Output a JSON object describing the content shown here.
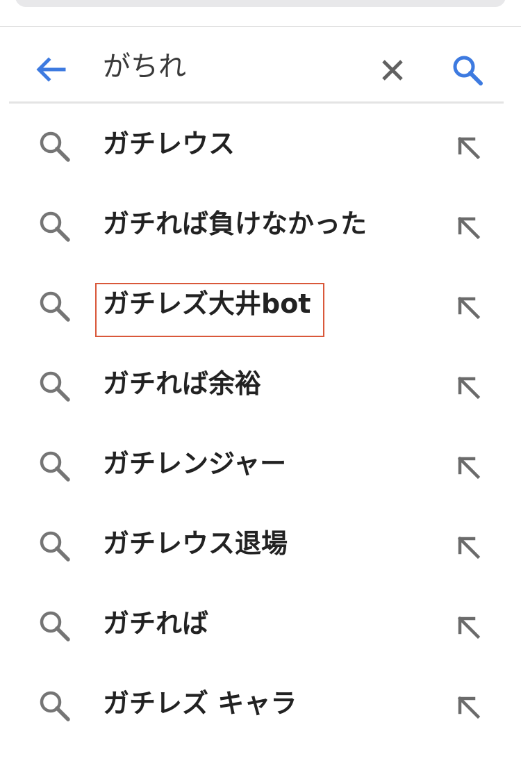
{
  "search": {
    "query": "がちれ"
  },
  "icons": {
    "back": "arrow-left-icon",
    "clear": "close-icon",
    "submit": "search-icon",
    "suggestion": "search-icon",
    "fill": "arrow-up-left-icon"
  },
  "colors": {
    "accent": "#3d7ae0",
    "icon_gray": "#757575",
    "highlight": "#d9583a",
    "text": "#222222"
  },
  "suggestions": [
    {
      "label": "ガチレウス"
    },
    {
      "label": "ガチれば負けなかった"
    },
    {
      "label": "ガチレズ大井bot",
      "highlighted": true
    },
    {
      "label": "ガチれば余裕"
    },
    {
      "label": "ガチレンジャー"
    },
    {
      "label": "ガチレウス退場"
    },
    {
      "label": "ガチれば"
    },
    {
      "label": "ガチレズ キャラ"
    }
  ]
}
